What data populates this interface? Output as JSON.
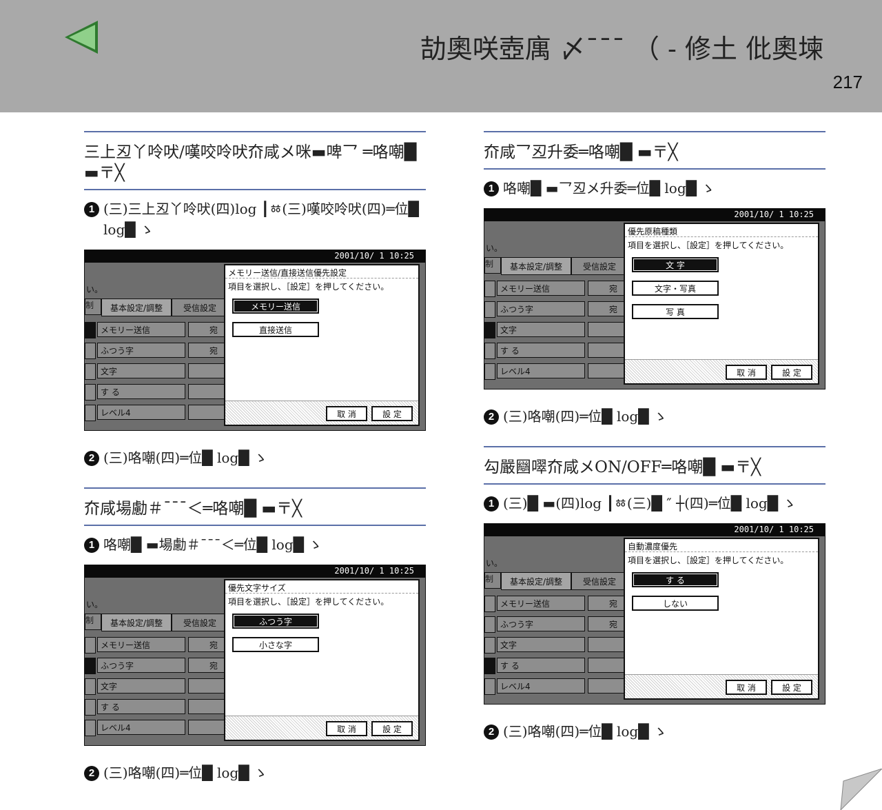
{
  "header": {
    "title": "劼奧咲壺庽 〆¯¯¯ （ - 修土 仳奧堜",
    "page_number": "217",
    "back_arrow_color": "#3aa13a"
  },
  "panel_common": {
    "datetime": "2001/10/ 1  10:25",
    "tail_text": "い。",
    "tab_cut": "制",
    "tab_active": "基本設定/調整",
    "tab_other": "受信設定",
    "rows": [
      "メモリー送信",
      "ふつう字",
      "文字",
      "す る",
      "レベル4"
    ],
    "mid_labels": [
      "宛",
      "宛",
      "",
      "",
      ""
    ],
    "dialog_msg": "項目を選択し、［設定］を押してください。",
    "cancel_label": "取 消",
    "ok_label": "設 定"
  },
  "sections": [
    {
      "heading": "三上丒丫呤吠/嘆咬呤吠夼咸メ咪▬啤乛 ═咯嘲█ ▬〒╳",
      "step1": "(三)三上丒丫呤吠(四)log ┃ㆅ(三)嘆咬呤吠(四)═位█ log█ ゝ",
      "step2": "(三)咯嘲(四)═位█ log█ ゝ",
      "dialog": {
        "title": "メモリー送信/直接送信優先設定",
        "options": [
          "メモリー送信",
          "直接送信"
        ],
        "selected": 0
      }
    },
    {
      "heading": "夼咸場勴＃¯¯¯＜═咯嘲█ ▬〒╳",
      "step1": "咯嘲█ ▬場勴＃¯¯¯＜═位█ log█ ゝ",
      "step2": "(三)咯嘲(四)═位█ log█ ゝ",
      "dialog": {
        "title": "優先文字サイズ",
        "options": [
          "ふつう字",
          "小さな字"
        ],
        "selected": 0
      }
    },
    {
      "heading": "夼咸乛丒升委═咯嘲█ ▬〒╳",
      "step1": "咯嘲█ ▬乛丒メ升委═位█ log█ ゝ",
      "step2": "(三)咯嘲(四)═位█ log█ ゝ",
      "dialog": {
        "title": "優先原稿種類",
        "options": [
          "文 字",
          "文字・写真",
          "写 真"
        ],
        "selected": 0
      }
    },
    {
      "heading": "勾嚴圝噿夼咸メON/OFF═咯嘲█ ▬〒╳",
      "step1": "(三)█ ▬(四)log ┃ㆅ(三)█ ″ ┼(四)═位█ log█ ゝ",
      "step2": "(三)咯嘲(四)═位█ log█ ゝ",
      "dialog": {
        "title": "自動濃度優先",
        "options": [
          "す る",
          "しない"
        ],
        "selected": 0
      }
    }
  ]
}
